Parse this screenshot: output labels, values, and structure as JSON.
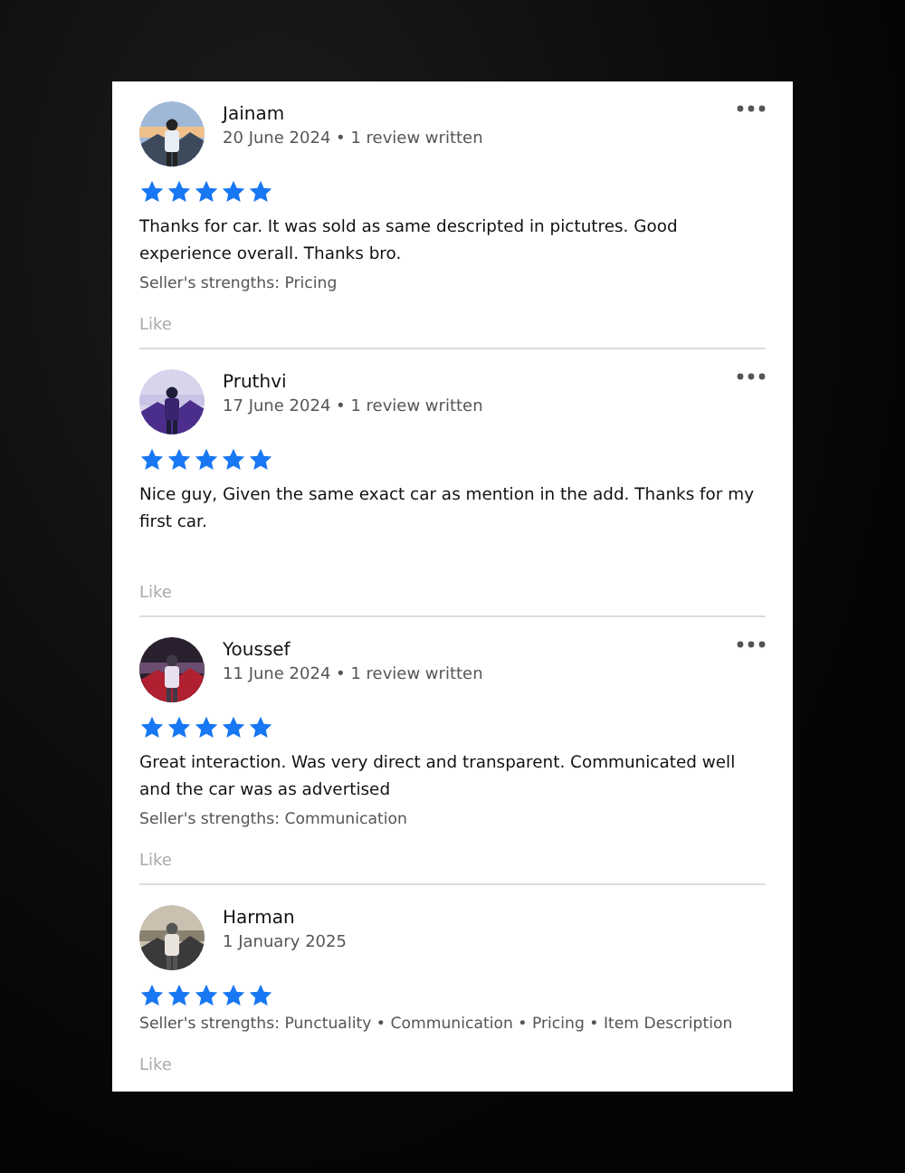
{
  "reviews": [
    {
      "name": "Jainam",
      "meta": "20 June 2024 • 1 review written",
      "stars": 5,
      "text": "Thanks for car. It was sold as same descripted in pictutres. Good experience overall. Thanks bro.",
      "strengths": "Seller's strengths: Pricing",
      "like": "Like",
      "menu": true
    },
    {
      "name": "Pruthvi",
      "meta": "17 June 2024 • 1 review written",
      "stars": 5,
      "text": "Nice guy, Given the same exact car as mention in the add. Thanks for my first car.",
      "like": "Like",
      "menu": true
    },
    {
      "name": "Youssef",
      "meta": "11 June 2024 • 1 review written",
      "stars": 5,
      "text": "Great interaction. Was very direct and transparent. Communicated well and the car was as advertised",
      "strengths": "Seller's strengths: Communication",
      "like": "Like",
      "menu": true
    },
    {
      "name": "Harman",
      "meta": "1 January 2025",
      "stars": 5,
      "strengths": "Seller's strengths: Punctuality • Communication • Pricing • Item Description",
      "like": "Like",
      "menu": false
    }
  ]
}
